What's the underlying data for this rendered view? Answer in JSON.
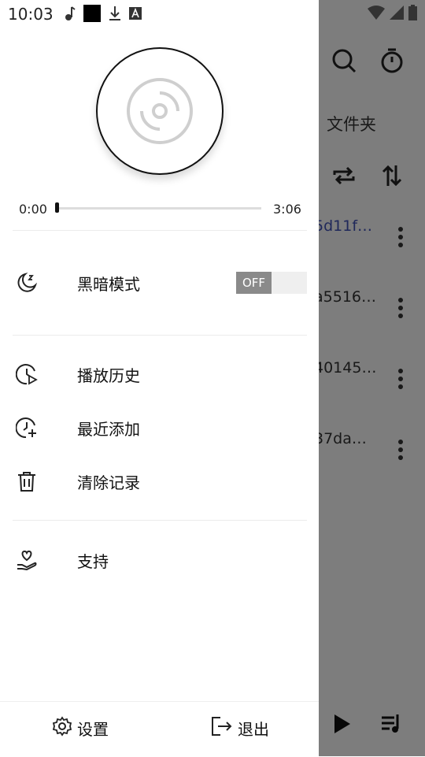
{
  "status_bar": {
    "time": "10:03"
  },
  "player": {
    "elapsed": "0:00",
    "duration": "3:06",
    "progress_fraction": 0.0
  },
  "menu": {
    "dark_mode": {
      "label": "黑暗模式",
      "toggle_label": "OFF",
      "toggle_on": false
    },
    "play_history": {
      "label": "播放历史"
    },
    "recently_added": {
      "label": "最近添加"
    },
    "clear_history": {
      "label": "清除记录"
    },
    "support": {
      "label": "支持"
    }
  },
  "footer": {
    "settings_label": "设置",
    "exit_label": "退出"
  },
  "background": {
    "folder_label": "文件夹",
    "list_items": [
      "5d11f…",
      "a5516…",
      "40145…",
      "37da…"
    ]
  },
  "colors": {
    "overlay": "#808080",
    "list_link": "#3f51b5",
    "toggle_off": "#8a8a8a"
  },
  "icons": {
    "status": [
      "music-note-icon",
      "black-square-icon",
      "download-icon",
      "font-icon",
      "wifi-icon",
      "signal-icon",
      "battery-icon"
    ],
    "drawer": [
      "moon-icon",
      "clock-play-icon",
      "clock-plus-icon",
      "trash-icon",
      "heart-hand-icon",
      "gear-icon",
      "exit-icon"
    ],
    "background": [
      "search-icon",
      "timer-icon",
      "repeat-icon",
      "sort-icon",
      "play-icon",
      "queue-icon",
      "more-vertical-icon"
    ]
  }
}
